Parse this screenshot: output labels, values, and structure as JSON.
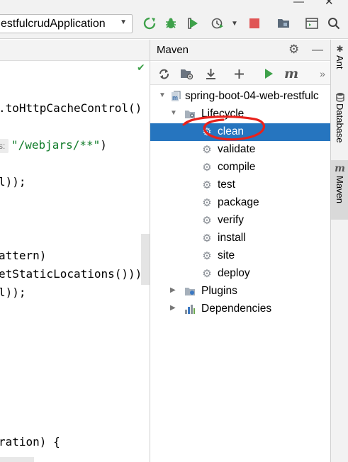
{
  "toolbar": {
    "run_config": "estfulcrudApplication",
    "window_controls": {
      "minimize": "—",
      "close": "✕"
    },
    "icons": [
      "build-icon",
      "debug-icon",
      "coverage-icon",
      "profile-icon",
      "stop-icon",
      "project-structure-icon",
      "terminal-icon",
      "search-icon"
    ],
    "accent": {
      "green": "#3ea14a",
      "red": "#e05555"
    }
  },
  "editor": {
    "lines": {
      "l1": ".toHttpCacheControl()",
      "l2_hint": "s:",
      "l2_string": "\"/webjars/**\"",
      "l2_close": ")",
      "l3": "l));",
      "l4": "attern)",
      "l5": "etStaticLocations()))",
      "l6": "l));",
      "l7": "ration) {"
    }
  },
  "maven": {
    "title": "Maven",
    "project": "spring-boot-04-web-restfulc",
    "lifecycle_label": "Lifecycle",
    "goals": [
      "clean",
      "validate",
      "compile",
      "test",
      "package",
      "verify",
      "install",
      "site",
      "deploy"
    ],
    "selected_goal": "clean",
    "plugins_label": "Plugins",
    "dependencies_label": "Dependencies",
    "more": "»",
    "selection_color": "#2675bf",
    "annotation_color": "#e8221c"
  },
  "tool_strip": {
    "ant": "Ant",
    "database": "Database",
    "maven": "Maven"
  }
}
